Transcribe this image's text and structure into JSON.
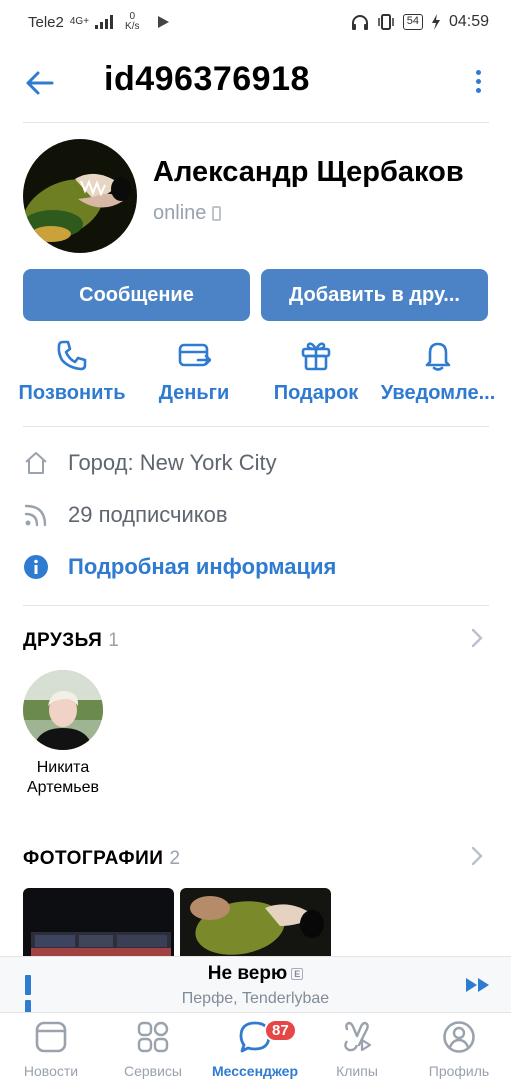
{
  "status_bar": {
    "carrier": "Tele2",
    "network": "4G+",
    "speed_value": "0",
    "speed_unit": "K/s",
    "battery": "54",
    "time": "04:59"
  },
  "header": {
    "title": "id496376918"
  },
  "profile": {
    "name": "Александр Щербаков",
    "status": "online"
  },
  "buttons": {
    "message": "Сообщение",
    "add_friend": "Добавить в дру..."
  },
  "actions": [
    {
      "label": "Позвонить",
      "icon": "phone-icon"
    },
    {
      "label": "Деньги",
      "icon": "money-icon"
    },
    {
      "label": "Подарок",
      "icon": "gift-icon"
    },
    {
      "label": "Уведомле...",
      "icon": "bell-icon"
    }
  ],
  "info": {
    "city": "Город: New York City",
    "followers": "29 подписчиков",
    "more": "Подробная информация"
  },
  "friends": {
    "title": "ДРУЗЬЯ",
    "count": "1",
    "items": [
      {
        "first_name": "Никита",
        "last_name": "Артемьев"
      }
    ]
  },
  "photos": {
    "title": "ФОТОГРАФИИ",
    "count": "2"
  },
  "player": {
    "title": "Не верю",
    "explicit": "E",
    "artist": "Перфе, Tenderlybae"
  },
  "tabs": [
    {
      "label": "Новости",
      "icon": "news-icon"
    },
    {
      "label": "Сервисы",
      "icon": "services-icon"
    },
    {
      "label": "Мессенджер",
      "icon": "messenger-icon",
      "badge": "87"
    },
    {
      "label": "Клипы",
      "icon": "clips-icon"
    },
    {
      "label": "Профиль",
      "icon": "profile-icon"
    }
  ],
  "colors": {
    "accent": "#2f7bd1",
    "button": "#4c83c6",
    "badge": "#e64646"
  }
}
